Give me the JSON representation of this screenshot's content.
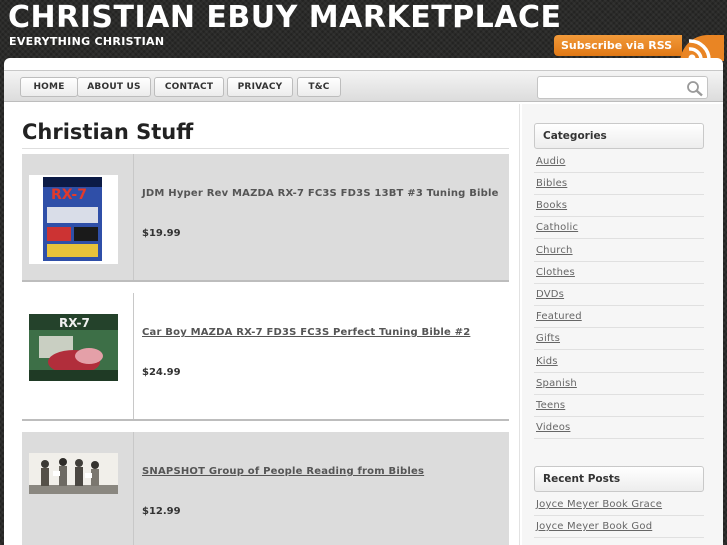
{
  "header": {
    "title": "CHRISTIAN EBUY MARKETPLACE",
    "tagline": "EVERYTHING CHRISTIAN",
    "rss_label": "Subscribe via RSS"
  },
  "nav": {
    "items": [
      "HOME",
      "ABOUT US",
      "CONTACT",
      "PRIVACY",
      "T&C"
    ],
    "search_placeholder": ""
  },
  "main": {
    "page_title": "Christian Stuff",
    "products": [
      {
        "title": "JDM Hyper Rev MAZDA RX-7 FC3S FD3S 13BT #3 Tuning Bible",
        "price": "$19.99"
      },
      {
        "title": "Car Boy MAZDA RX-7 FD3S FC3S Perfect Tuning Bible #2",
        "price": "$24.99"
      },
      {
        "title": "SNAPSHOT Group of People Reading from Bibles",
        "price": "$12.99"
      }
    ]
  },
  "sidebar": {
    "categories_heading": "Categories",
    "categories": [
      "Audio",
      "Bibles",
      "Books",
      "Catholic",
      "Church",
      "Clothes",
      "DVDs",
      "Featured",
      "Gifts",
      "Kids",
      "Spanish",
      "Teens",
      "Videos"
    ],
    "recent_heading": "Recent Posts",
    "recent_posts": [
      "Joyce Meyer Book Grace",
      "Joyce Meyer Book God"
    ]
  },
  "colors": {
    "background": "#2b2b29",
    "rss_orange": "#e07815",
    "product_shade": "#dcdcdc"
  }
}
